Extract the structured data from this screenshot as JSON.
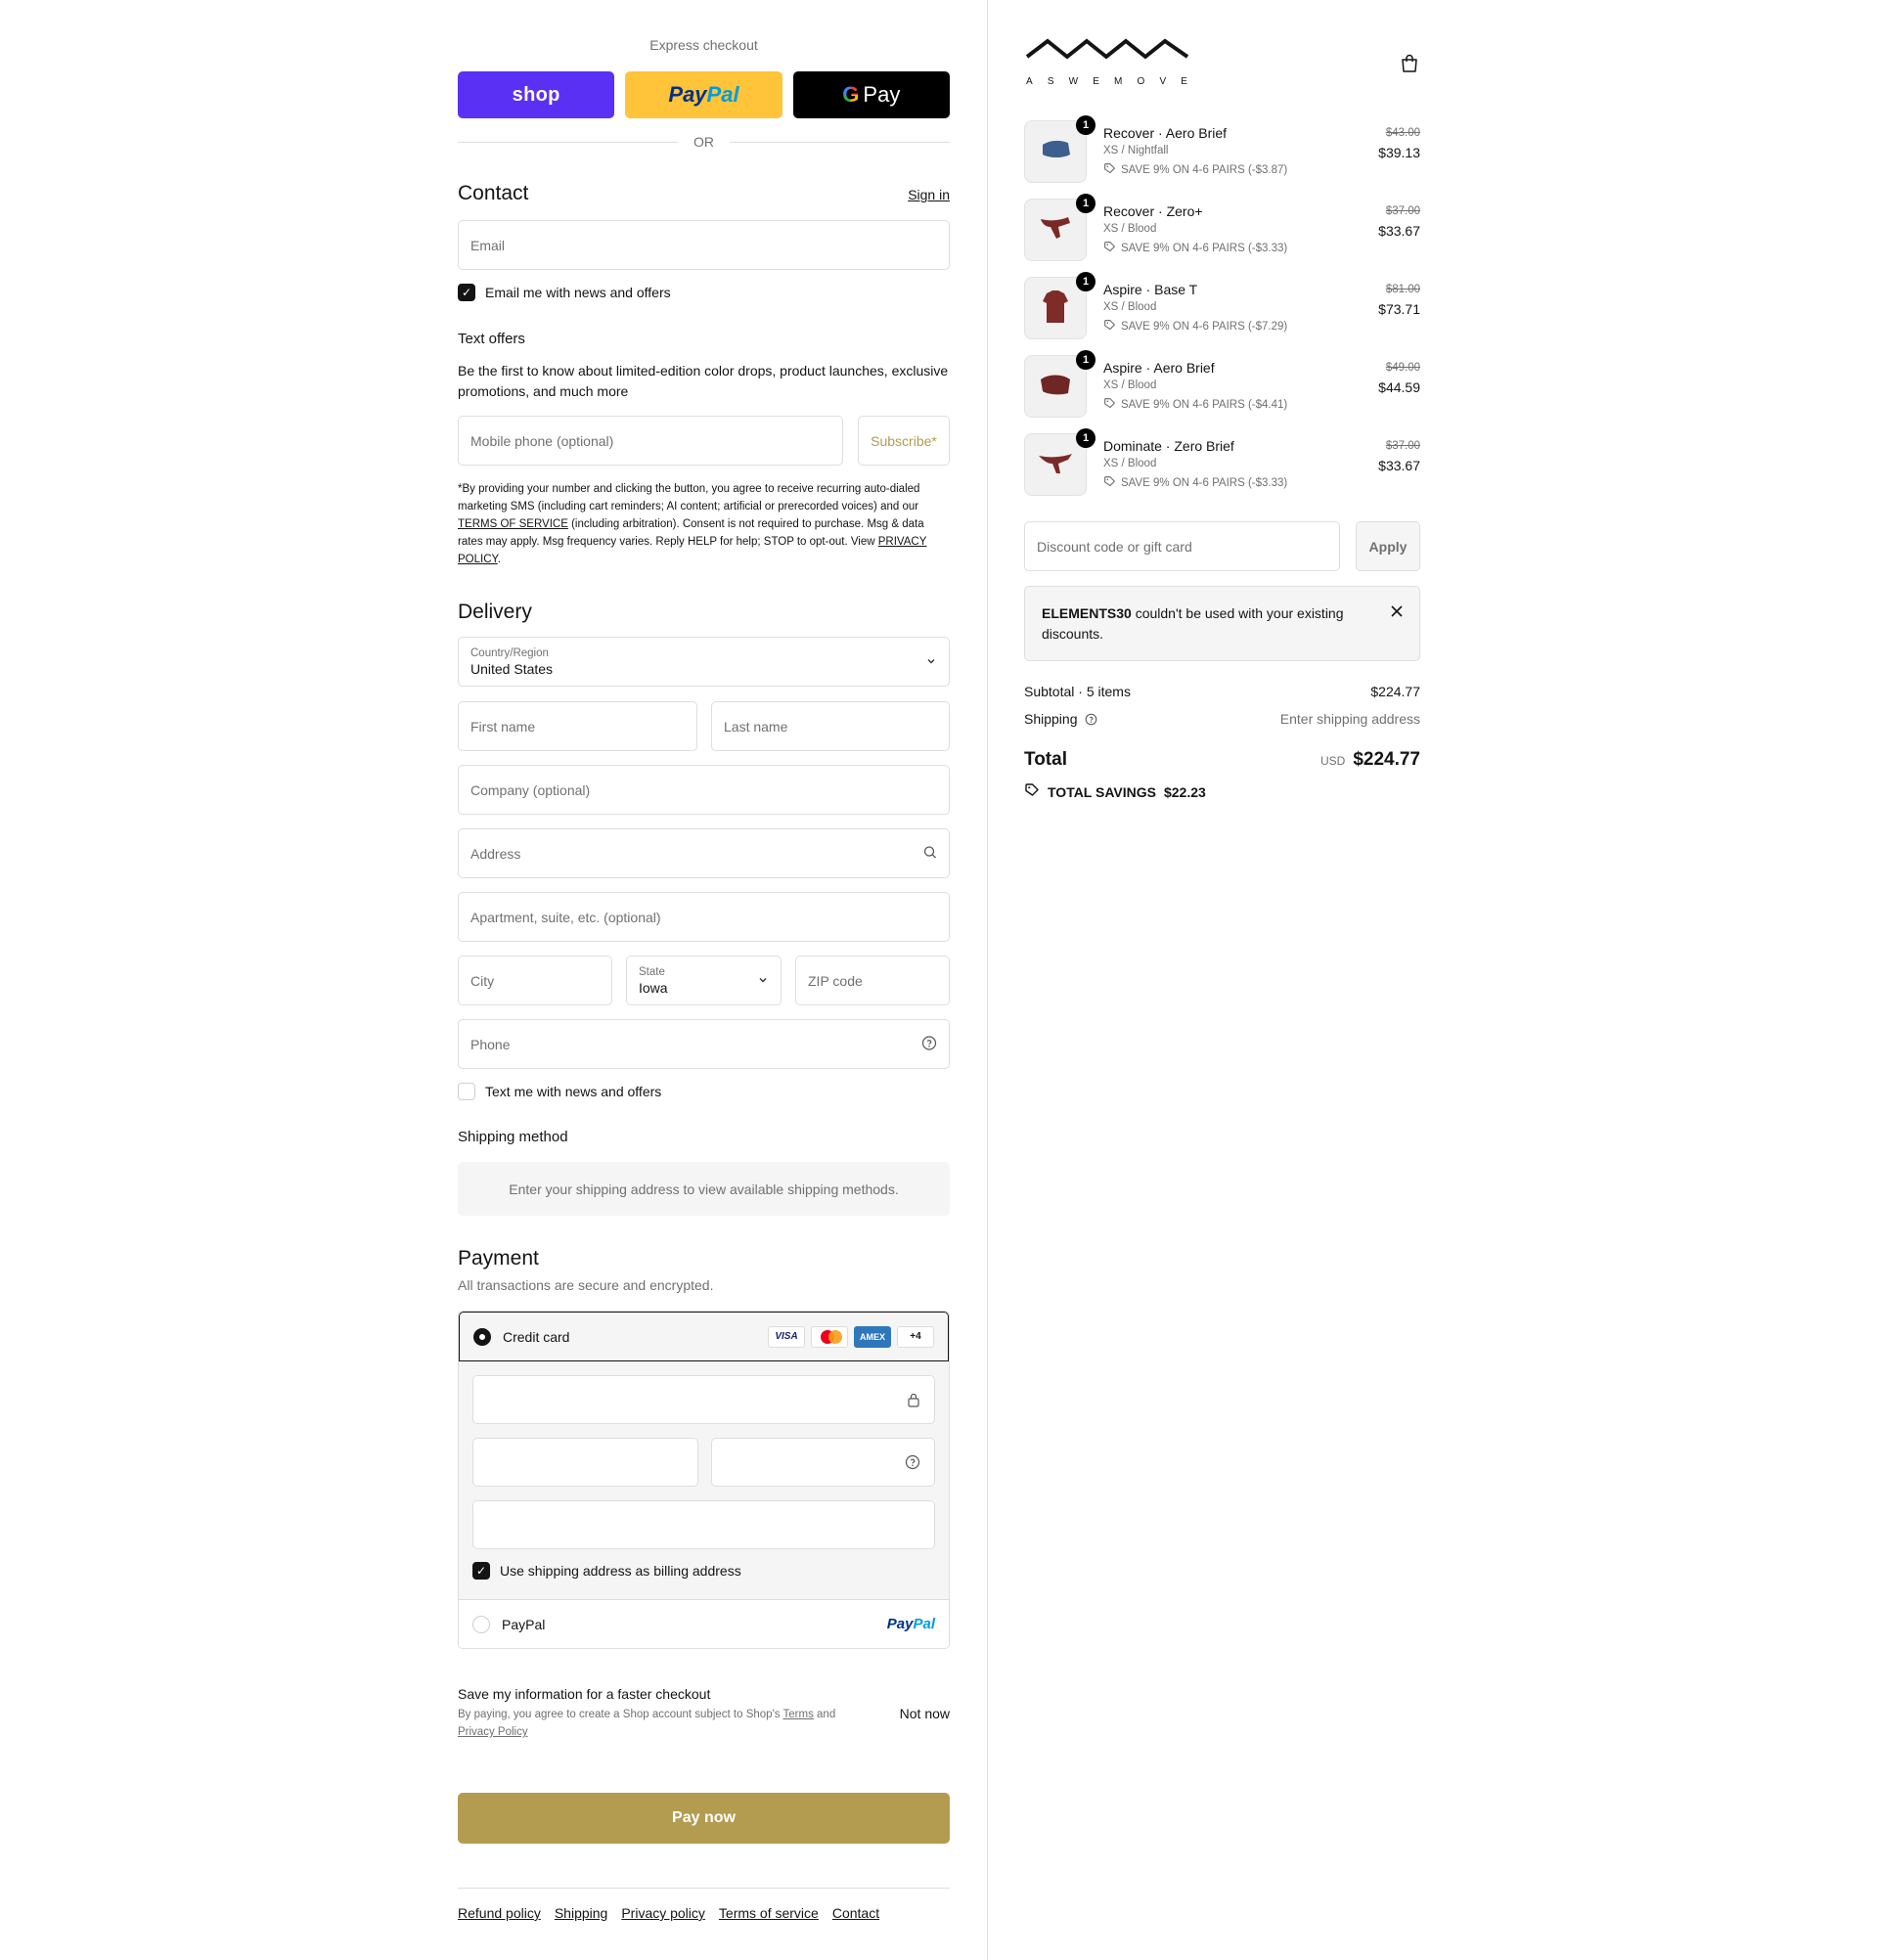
{
  "express": {
    "title": "Express checkout",
    "shop_label": "shop",
    "paypal_label_1": "Pay",
    "paypal_label_2": "Pal",
    "gpay_g": "G",
    "gpay_label": "Pay",
    "or": "OR"
  },
  "contact": {
    "title": "Contact",
    "signin": "Sign in",
    "email_placeholder": "Email",
    "email_news": "Email me with news and offers",
    "email_news_checked": true
  },
  "text_offers": {
    "title": "Text offers",
    "description": "Be the first to know about limited-edition color drops, product launches, exclusive promotions, and much more",
    "phone_placeholder": "Mobile phone (optional)",
    "subscribe": "Subscribe*",
    "fine_1": "*By providing your number and clicking the button, you agree to receive recurring auto-dialed marketing SMS (including cart reminders; AI content; artificial or prerecorded voices) and our ",
    "fine_terms": "TERMS OF SERVICE",
    "fine_2": " (including arbitration). Consent is not required to purchase. Msg & data rates may apply. Msg frequency varies. Reply HELP for help; STOP to opt-out. View ",
    "fine_privacy": "PRIVACY POLICY",
    "fine_3": "."
  },
  "delivery": {
    "title": "Delivery",
    "country_label": "Country/Region",
    "country_value": "United States",
    "first_name": "First name",
    "last_name": "Last name",
    "company": "Company (optional)",
    "address": "Address",
    "apartment": "Apartment, suite, etc. (optional)",
    "city": "City",
    "state_label": "State",
    "state_value": "Iowa",
    "zip": "ZIP code",
    "phone": "Phone",
    "text_news": "Text me with news and offers",
    "text_news_checked": false
  },
  "shipping_method": {
    "title": "Shipping method",
    "message": "Enter your shipping address to view available shipping methods."
  },
  "payment": {
    "title": "Payment",
    "subtitle": "All transactions are secure and encrypted.",
    "credit_card": "Credit card",
    "card_logos": [
      "VISA",
      "",
      "AMEX",
      "+4"
    ],
    "billing_same": "Use shipping address as billing address",
    "paypal": "PayPal",
    "paypal_logo_1": "Pay",
    "paypal_logo_2": "Pal"
  },
  "save_info": {
    "title": "Save my information for a faster checkout",
    "sub_1": "By paying, you agree to create a Shop account subject to Shop's ",
    "terms": "Terms",
    "sub_2": " and ",
    "privacy": "Privacy Policy",
    "not_now": "Not now"
  },
  "pay_now": "Pay now",
  "footer": [
    "Refund policy",
    "Shipping",
    "Privacy policy",
    "Terms of service",
    "Contact"
  ],
  "brand": {
    "wordmark": [
      "A",
      "S",
      "W",
      "E",
      "M",
      "O",
      "V",
      "E"
    ]
  },
  "cart": {
    "items": [
      {
        "qty": "1",
        "name": "Recover · Aero Brief",
        "variant": "XS / Nightfall",
        "discount": "SAVE 9% ON 4-6 PAIRS (-$3.87)",
        "old_price": "$43.00",
        "price": "$39.13",
        "color": "#3c5f8f"
      },
      {
        "qty": "1",
        "name": "Recover · Zero+",
        "variant": "XS / Blood",
        "discount": "SAVE 9% ON 4-6 PAIRS (-$3.33)",
        "old_price": "$37.00",
        "price": "$33.67",
        "color": "#7a2a26"
      },
      {
        "qty": "1",
        "name": "Aspire · Base T",
        "variant": "XS / Blood",
        "discount": "SAVE 9% ON 4-6 PAIRS (-$7.29)",
        "old_price": "$81.00",
        "price": "$73.71",
        "color": "#7d2c28"
      },
      {
        "qty": "1",
        "name": "Aspire · Aero Brief",
        "variant": "XS / Blood",
        "discount": "SAVE 9% ON 4-6 PAIRS (-$4.41)",
        "old_price": "$49.00",
        "price": "$44.59",
        "color": "#6e2724"
      },
      {
        "qty": "1",
        "name": "Dominate · Zero Brief",
        "variant": "XS / Blood",
        "discount": "SAVE 9% ON 4-6 PAIRS (-$3.33)",
        "old_price": "$37.00",
        "price": "$33.67",
        "color": "#7a2a26"
      }
    ],
    "discount_placeholder": "Discount code or gift card",
    "apply": "Apply",
    "alert_code": "ELEMENTS30",
    "alert_text": " couldn't be used with your existing discounts.",
    "subtotal_label": "Subtotal · 5 items",
    "subtotal_value": "$224.77",
    "shipping_label": "Shipping",
    "shipping_value": "Enter shipping address",
    "total_label": "Total",
    "currency": "USD",
    "total_value": "$224.77",
    "savings_label": "TOTAL SAVINGS",
    "savings_value": "$22.23"
  }
}
